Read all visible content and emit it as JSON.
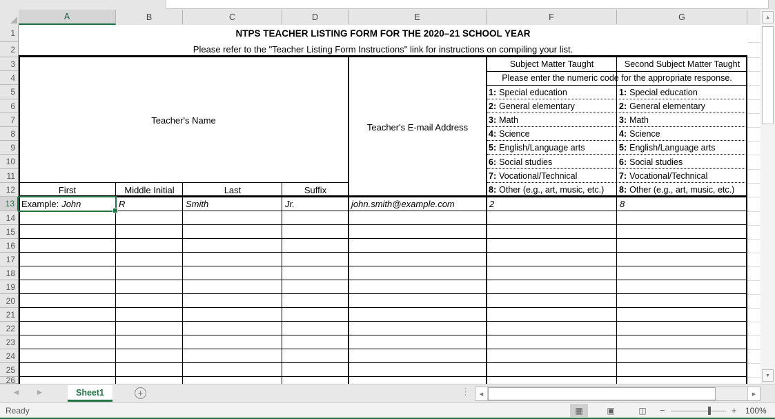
{
  "app": {
    "status": "Ready",
    "zoom_level": "100%",
    "sheet_tab": "Sheet1",
    "add_sheet_label": "+"
  },
  "colors": {
    "accent_green": "#217346",
    "header_gray": "#e6e6e6",
    "selected_header_gray": "#d5d5d5"
  },
  "icons": {
    "up_arrow": "▲",
    "down_arrow": "▼",
    "left_arrow": "◀",
    "right_arrow": "▶",
    "grip": "⋮",
    "normal_view": "▦",
    "page_layout_view": "▣",
    "page_break_view": "◫",
    "zoom_out": "−",
    "zoom_in": "+"
  },
  "grid": {
    "column_letters": [
      "A",
      "B",
      "C",
      "D",
      "E",
      "F",
      "G"
    ],
    "row_numbers": [
      "1",
      "2",
      "3",
      "4",
      "5",
      "6",
      "7",
      "8",
      "9",
      "10",
      "11",
      "12",
      "13",
      "14",
      "15",
      "16",
      "17",
      "18",
      "19",
      "20",
      "21",
      "22",
      "23",
      "24",
      "25",
      "26"
    ]
  },
  "form": {
    "title": "NTPS TEACHER LISTING FORM FOR THE 2020–21 SCHOOL YEAR",
    "subtitle": "Please refer to the \"Teacher Listing Form Instructions\" link for instructions on compiling your list.",
    "teachers_name_label": "Teacher's Name",
    "email_label": "Teacher's E-mail Address",
    "subject_header": "Subject Matter Taught",
    "second_subject_header": "Second Subject Matter Taught",
    "code_instruction": "Please enter the numeric code for the appropriate response.",
    "codes": [
      {
        "num": "1:",
        "label": "Special education"
      },
      {
        "num": "2:",
        "label": "General elementary"
      },
      {
        "num": "3:",
        "label": "Math"
      },
      {
        "num": "4:",
        "label": "Science"
      },
      {
        "num": "5:",
        "label": "English/Language arts"
      },
      {
        "num": "6:",
        "label": "Social studies"
      },
      {
        "num": "7:",
        "label": "Vocational/Technical"
      },
      {
        "num": "8:",
        "label": "Other (e.g., art, music, etc.)"
      }
    ],
    "name_headers": {
      "first": "First",
      "middle": "Middle Initial",
      "last": "Last",
      "suffix": "Suffix"
    },
    "example_row": {
      "prefix": "Example:",
      "first": "John",
      "middle": "R",
      "last": "Smith",
      "suffix": "Jr.",
      "email": "john.smith@example.com",
      "subject_code": "2",
      "second_subject_code": "8"
    }
  }
}
